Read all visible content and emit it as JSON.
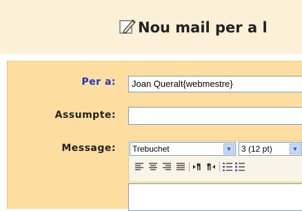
{
  "header": {
    "title": "Nou mail per a l"
  },
  "form": {
    "to_label": "Per a:",
    "to_value": "Joan Queralt{webmestre}",
    "subject_label": "Assumpte:",
    "subject_value": "",
    "message_label": "Message:"
  },
  "editor": {
    "font_family": "Trebuchet",
    "font_size": "3 (12 pt)",
    "toolbar_icons": [
      "align-left-icon",
      "align-center-icon",
      "align-right-icon",
      "justify-icon",
      "ltr-icon",
      "rtl-icon",
      "ordered-list-icon",
      "unordered-list-icon"
    ]
  },
  "colors": {
    "header_bg": "#fdf0d8",
    "panel_bg": "#fddea0",
    "to_label": "#1a35c6"
  }
}
